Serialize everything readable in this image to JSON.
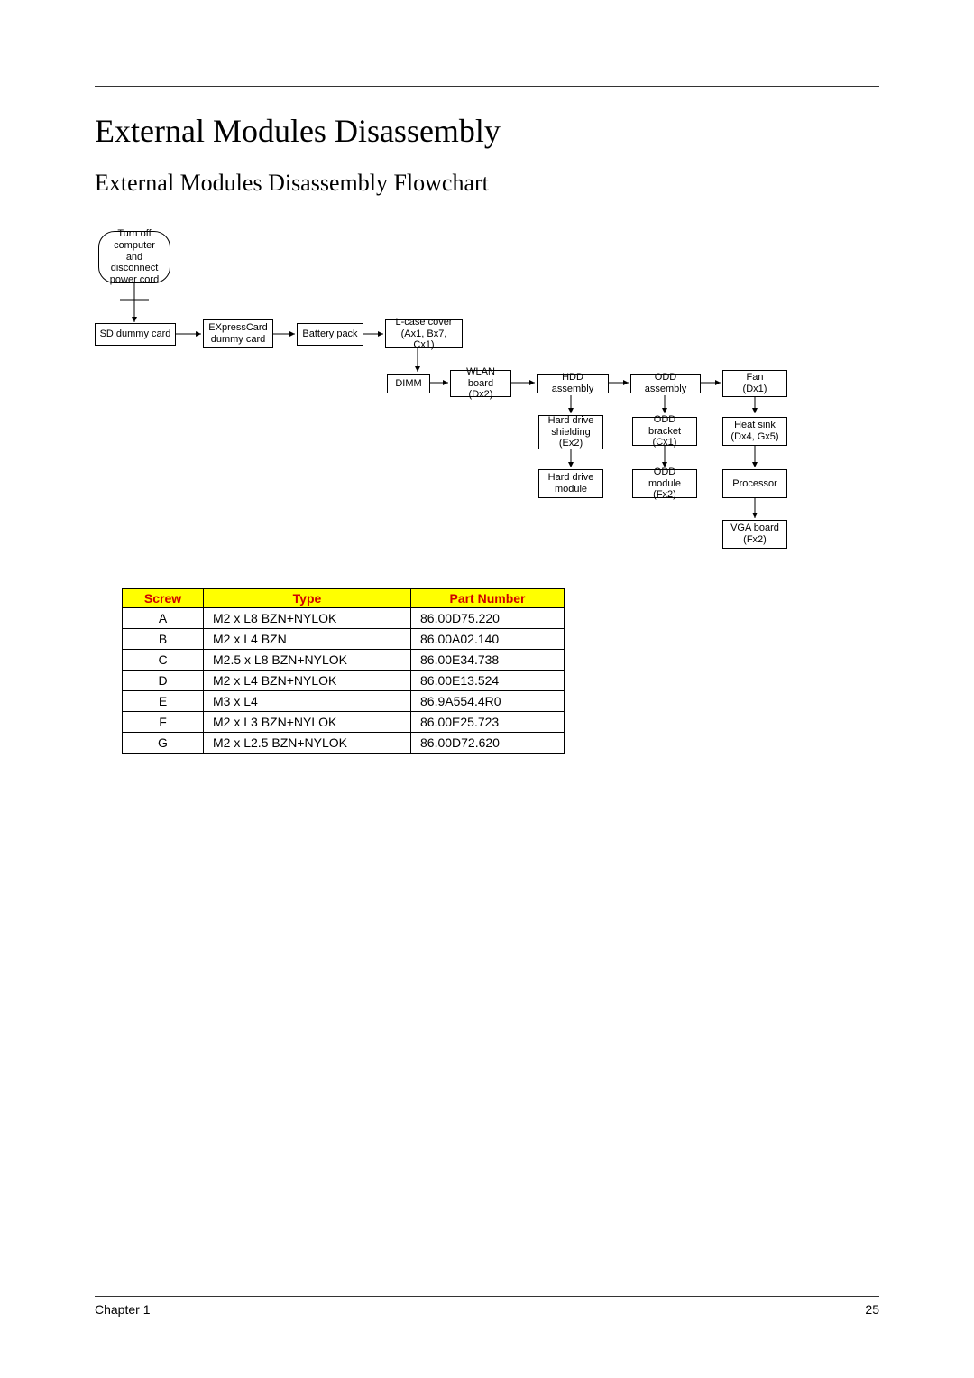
{
  "headings": {
    "h1": "External Modules Disassembly",
    "h2": "External Modules Disassembly Flowchart"
  },
  "flow": {
    "start": "Turn off computer and disconnect power cord",
    "sd": "SD dummy card",
    "express": "EXpressCard dummy card",
    "battery": "Battery pack",
    "lcase": {
      "t": "L-case cover",
      "s": "(Ax1, Bx7, Cx1)"
    },
    "dimm": "DIMM",
    "wlan": {
      "t": "WLAN board",
      "s": "(Dx2)"
    },
    "hddasm": "HDD assembly",
    "oddasm": "ODD assembly",
    "fan": {
      "t": "Fan",
      "s": "(Dx1)"
    },
    "hdshield": {
      "t": "Hard drive shielding",
      "s": "(Ex2)"
    },
    "oddbracket": {
      "t": "ODD bracket",
      "s": "(Cx1)"
    },
    "heatsink": {
      "t": "Heat sink",
      "s": "(Dx4, Gx5)"
    },
    "hdmodule": "Hard drive module",
    "oddmodule": {
      "t": "ODD module",
      "s": "(Fx2)"
    },
    "processor": "Processor",
    "vga": {
      "t": "VGA board",
      "s": "(Fx2)"
    }
  },
  "table": {
    "headers": {
      "screw": "Screw",
      "type": "Type",
      "part": "Part Number"
    },
    "rows": [
      {
        "screw": "A",
        "type": "M2 x L8 BZN+NYLOK",
        "part": "86.00D75.220"
      },
      {
        "screw": "B",
        "type": "M2 x L4 BZN",
        "part": "86.00A02.140"
      },
      {
        "screw": "C",
        "type": "M2.5 x L8 BZN+NYLOK",
        "part": "86.00E34.738"
      },
      {
        "screw": "D",
        "type": "M2 x L4 BZN+NYLOK",
        "part": "86.00E13.524"
      },
      {
        "screw": "E",
        "type": "M3 x L4",
        "part": "86.9A554.4R0"
      },
      {
        "screw": "F",
        "type": "M2 x L3 BZN+NYLOK",
        "part": "86.00E25.723"
      },
      {
        "screw": "G",
        "type": "M2 x L2.5 BZN+NYLOK",
        "part": "86.00D72.620"
      }
    ]
  },
  "footer": {
    "left": "Chapter 1",
    "right": "25"
  }
}
